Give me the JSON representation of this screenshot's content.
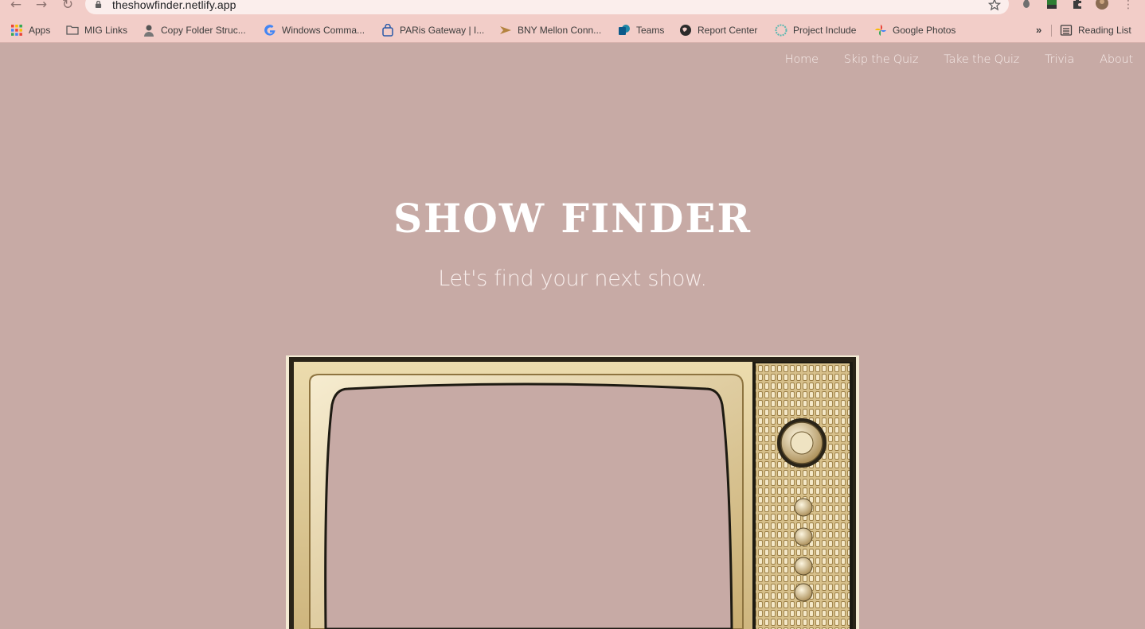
{
  "browser": {
    "url": "theshowfinder.netlify.app",
    "bookmarks": [
      {
        "label": "Apps",
        "icon": "apps-grid-icon"
      },
      {
        "label": "MIG Links",
        "icon": "folder-icon"
      },
      {
        "label": "Copy Folder Struc...",
        "icon": "avatar-icon"
      },
      {
        "label": "Windows Comma...",
        "icon": "google-icon"
      },
      {
        "label": "PARis Gateway | I...",
        "icon": "lock-building-icon"
      },
      {
        "label": "BNY Mellon Conn...",
        "icon": "arrow-logo-icon"
      },
      {
        "label": "Teams",
        "icon": "sharepoint-icon"
      },
      {
        "label": "Report Center",
        "icon": "globe-icon"
      },
      {
        "label": "Project Include",
        "icon": "flower-icon"
      },
      {
        "label": "Google Photos",
        "icon": "pinwheel-icon"
      }
    ],
    "more_bookmarks": "»",
    "reading_list": "Reading List"
  },
  "site": {
    "nav": [
      "Home",
      "Skip the Quiz",
      "Take the Quiz",
      "Trivia",
      "About"
    ],
    "title": "SHOW FINDER",
    "subtitle": "Let's find your next show."
  },
  "colors": {
    "page_bg": "#c7aaa5",
    "chrome_bg": "#f2cdc8",
    "tv_body": "#e2cf9e"
  }
}
